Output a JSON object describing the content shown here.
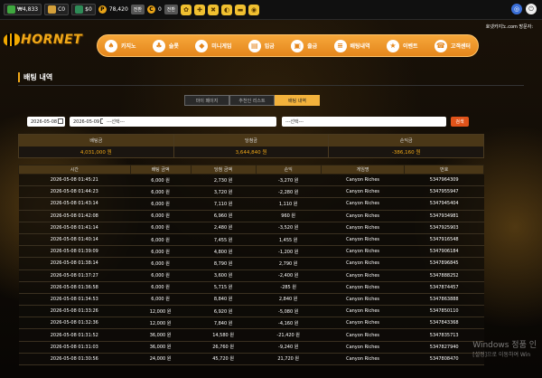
{
  "topbar": {
    "krw": "₩4,833",
    "cash": "C0",
    "dollar": "$0",
    "points": "78,420",
    "points_btn": "전환",
    "coin_c": "0",
    "coin_btn": "전환",
    "icons": [
      "money-icon",
      "cash-icon",
      "dollar-icon",
      "points-icon",
      "coin-icon",
      "gift-icon",
      "settings-icon",
      "refresh-icon",
      "bell-icon",
      "chat-icon",
      "speech-icon"
    ]
  },
  "brand": {
    "name": "HORNET"
  },
  "welcome": "호넷카지노.com 방문자:",
  "nav": [
    {
      "label": "카지노",
      "icon": "♠"
    },
    {
      "label": "슬롯",
      "icon": "♣"
    },
    {
      "label": "미니게임",
      "icon": "◆"
    },
    {
      "label": "입금",
      "icon": "▤"
    },
    {
      "label": "출금",
      "icon": "▣"
    },
    {
      "label": "배팅내역",
      "icon": "≡"
    },
    {
      "label": "이벤트",
      "icon": "★"
    },
    {
      "label": "고객센터",
      "icon": "☎"
    }
  ],
  "page": {
    "title": "배팅 내역"
  },
  "tabs": [
    {
      "label": "마이 페이지",
      "active": false
    },
    {
      "label": "추천인 리스트",
      "active": false
    },
    {
      "label": "배팅 내역",
      "active": true
    }
  ],
  "filter": {
    "date_from": "2026-05-08",
    "date_to": "2026-05-09",
    "select1": "---선택---",
    "select2": "---선택---",
    "search": "검색"
  },
  "summary": [
    {
      "label": "배팅금",
      "value": "4,031,000 원"
    },
    {
      "label": "당첨금",
      "value": "3,644,840 원"
    },
    {
      "label": "손익금",
      "value": "-386,160 원"
    }
  ],
  "table": {
    "headers": [
      "시간",
      "배팅 금액",
      "당첨 금액",
      "손익",
      "게임명",
      "번호"
    ],
    "rows": [
      [
        "2026-05-08 01:45:21",
        "6,000 원",
        "2,730 원",
        "-3,270 원",
        "Canyon Riches",
        "5347964309"
      ],
      [
        "2026-05-08 01:44:23",
        "6,000 원",
        "3,720 원",
        "-2,280 원",
        "Canyon Riches",
        "5347955947"
      ],
      [
        "2026-05-08 01:43:14",
        "6,000 원",
        "7,110 원",
        "1,110 원",
        "Canyon Riches",
        "5347945404"
      ],
      [
        "2026-05-08 01:42:08",
        "6,000 원",
        "6,960 원",
        "960 원",
        "Canyon Riches",
        "5347934981"
      ],
      [
        "2026-05-08 01:41:14",
        "6,000 원",
        "2,480 원",
        "-3,520 원",
        "Canyon Riches",
        "5347925903"
      ],
      [
        "2026-05-08 01:40:14",
        "6,000 원",
        "7,455 원",
        "1,455 원",
        "Canyon Riches",
        "5347916548"
      ],
      [
        "2026-05-08 01:39:09",
        "6,000 원",
        "4,800 원",
        "-1,200 원",
        "Canyon Riches",
        "5347906184"
      ],
      [
        "2026-05-08 01:38:14",
        "6,000 원",
        "8,790 원",
        "2,790 원",
        "Canyon Riches",
        "5347896845"
      ],
      [
        "2026-05-08 01:37:27",
        "6,000 원",
        "3,600 원",
        "-2,400 원",
        "Canyon Riches",
        "5347888252"
      ],
      [
        "2026-05-08 01:36:58",
        "6,000 원",
        "5,715 원",
        "-285 원",
        "Canyon Riches",
        "5347874457"
      ],
      [
        "2026-05-08 01:34:53",
        "6,000 원",
        "8,840 원",
        "2,840 원",
        "Canyon Riches",
        "5347863888"
      ],
      [
        "2026-05-08 01:33:26",
        "12,000 원",
        "6,920 원",
        "-5,080 원",
        "Canyon Riches",
        "5347850110"
      ],
      [
        "2026-05-08 01:32:36",
        "12,000 원",
        "7,840 원",
        "-4,160 원",
        "Canyon Riches",
        "5347843368"
      ],
      [
        "2026-05-08 01:31:52",
        "36,000 원",
        "14,580 원",
        "-21,420 원",
        "Canyon Riches",
        "5347835713"
      ],
      [
        "2026-05-08 01:31:03",
        "36,000 원",
        "26,760 원",
        "-9,240 원",
        "Canyon Riches",
        "5347827940"
      ],
      [
        "2026-05-08 01:30:56",
        "24,000 원",
        "45,720 원",
        "21,720 원",
        "Canyon Riches",
        "5347808470"
      ]
    ]
  },
  "watermark": {
    "line1": "Windows 정품 인",
    "line2": "[설정]으로 이동하여 Win"
  }
}
